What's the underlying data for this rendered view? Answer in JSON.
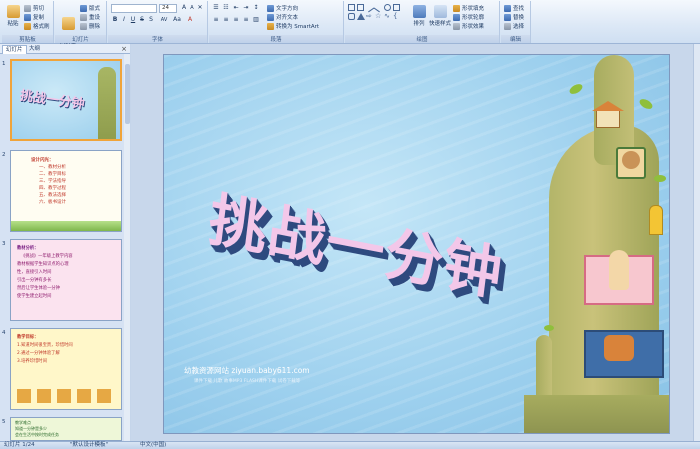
{
  "ribbon": {
    "clipboard": {
      "label": "剪贴板",
      "paste": "粘贴",
      "cut": "剪切",
      "copy": "复制",
      "format_painter": "格式刷"
    },
    "slides": {
      "label": "幻灯片",
      "new_slide": "新建\n幻灯片",
      "layout": "版式",
      "reset": "重设",
      "delete": "删除"
    },
    "font": {
      "label": "字体",
      "font_name": "",
      "font_size": "24",
      "bold": "B",
      "italic": "I",
      "underline": "U",
      "strike": "S",
      "shadow": "S",
      "spacing": "AV",
      "case": "Aa",
      "color": "A"
    },
    "paragraph": {
      "label": "段落",
      "text_direction": "文字方向",
      "align_text": "对齐文本",
      "convert_smartart": "转换为 SmartArt"
    },
    "drawing": {
      "label": "绘图",
      "arrange": "排列",
      "quick_styles": "快速样式",
      "shape_fill": "形状填充",
      "shape_outline": "形状轮廓",
      "shape_effects": "形状效果"
    },
    "editing": {
      "label": "编辑",
      "find": "查找",
      "replace": "替换",
      "select": "选择"
    }
  },
  "left_panel": {
    "tab_slides": "幻灯片",
    "tab_outline": "大纲",
    "close": "×",
    "thumbnails": [
      {
        "number": "1",
        "title": "挑战一分钟"
      },
      {
        "number": "2",
        "lines": [
          "设计闪光：",
          "一、教材分析",
          "二、教学目标",
          "三、学法指导",
          "四、教学过程",
          "五、教法选择",
          "六、板书设计"
        ]
      },
      {
        "number": "3",
        "lines": [
          "教材分析：",
          "《挑战》一年级上教学内容",
          "教材根据学生知识点的心理",
          "性，直接引入时间",
          "引出一分钟有多长",
          "然后让学生体验一分钟",
          "使学生建立起时间"
        ]
      },
      {
        "number": "4",
        "lines": [
          "教学目标：",
          "1.知道时间很宝贵，珍惜时间",
          "2.通过一分钟体验了解",
          "3.培养珍惜时间"
        ]
      },
      {
        "number": "5",
        "lines": [
          "教学难点",
          "知道一分钟是多少",
          "会在生活中按时完成任务"
        ]
      }
    ]
  },
  "slide": {
    "title": "挑战一分钟",
    "website": "幼教资源网站  ziyuan.baby611.com",
    "website_sub": "课件下载  儿歌  故事MP3  FLASH课件下载  试卷下载等"
  },
  "status": {
    "slide_count": "幻灯片 1/24",
    "theme": "\"默认设计模板\"",
    "language": "中文(中国)"
  },
  "colors": {
    "accent": "#f0a43a",
    "ribbon_bg": "#dce8f6",
    "title_face": "#f3c7e9",
    "title_depth": "#2e4a7f"
  }
}
